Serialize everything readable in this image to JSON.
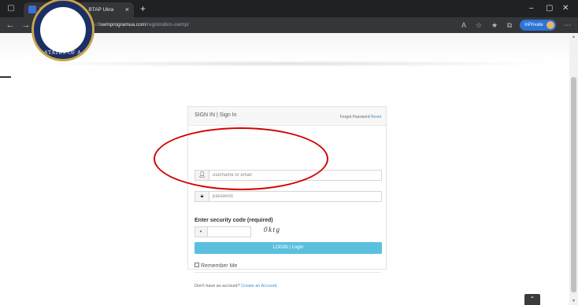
{
  "browser": {
    "tab_title": "Registration SWMP - BTAP Ukra",
    "tab_close": "×",
    "new_tab": "+",
    "url_scheme": "https://",
    "url_host": "swmprogramua.com",
    "url_path": "/registration-swmp/",
    "inprivate_label": "InPrivate",
    "icons": [
      "back-icon",
      "forward-icon",
      "refresh-icon",
      "home-icon",
      "lock-icon",
      "favorites-icon",
      "collections-icon",
      "extensions-icon"
    ]
  },
  "header": {
    "seal_text": "STATES OF A"
  },
  "login": {
    "title": "SIGN IN | Sign In",
    "forgot_label": "Forgot Password",
    "reset_label": "Reset",
    "username_placeholder": "username or email",
    "password_placeholder": "password",
    "security_label": "Enter security code (required)",
    "captcha_code": "0ktg",
    "login_button": "LOGIN | Login",
    "remember_label": "Remember Me",
    "no_account_text": "Don't have an account?",
    "create_account_link": "Create an Account"
  },
  "colors": {
    "login_button": "#5bc0de",
    "link": "#3b8fd6",
    "annotation": "#d40000",
    "browser_frame": "#202124"
  }
}
